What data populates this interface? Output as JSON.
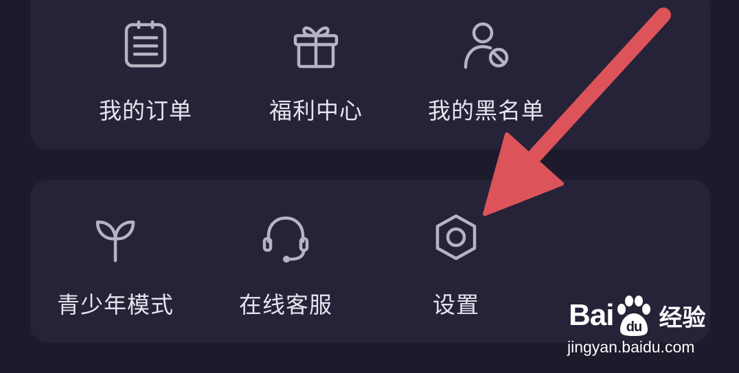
{
  "sections": [
    {
      "items": [
        {
          "label": "我的订单",
          "icon": "order-list-icon"
        },
        {
          "label": "福利中心",
          "icon": "gift-icon"
        },
        {
          "label": "我的黑名单",
          "icon": "user-block-icon"
        }
      ]
    },
    {
      "items": [
        {
          "label": "青少年模式",
          "icon": "sprout-icon"
        },
        {
          "label": "在线客服",
          "icon": "headset-icon"
        },
        {
          "label": "设置",
          "icon": "settings-hexagon-icon"
        }
      ]
    }
  ],
  "watermark": {
    "brand_left": "Bai",
    "brand_mid": "du",
    "brand_cn": "经验",
    "url": "jingyan.baidu.com"
  },
  "colors": {
    "background": "#1d1a2c",
    "card": "#262338",
    "icon_stroke": "#b7b3c2",
    "label": "#e6e4ee",
    "arrow": "#dc545a"
  }
}
